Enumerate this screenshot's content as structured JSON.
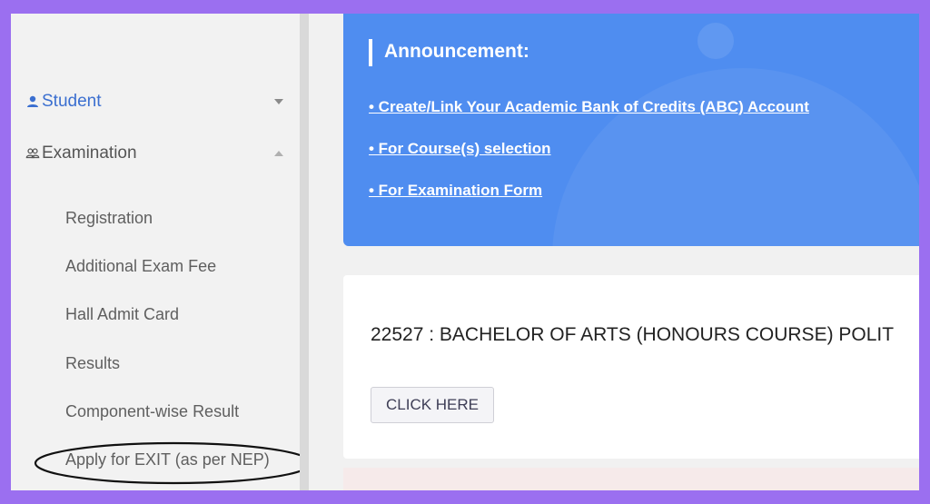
{
  "sidebar": {
    "student": {
      "label": "Student",
      "icon": "person-icon",
      "expanded": false
    },
    "examination": {
      "label": "Examination",
      "icon": "group-icon",
      "expanded": true,
      "items": [
        {
          "label": "Registration"
        },
        {
          "label": "Additional Exam Fee"
        },
        {
          "label": "Hall Admit Card"
        },
        {
          "label": "Results"
        },
        {
          "label": "Component-wise Result"
        },
        {
          "label": "Apply for EXIT (as per NEP)"
        }
      ]
    }
  },
  "announcement": {
    "title": "Announcement:",
    "links": [
      "• Create/Link Your Academic Bank of Credits (ABC) Account",
      "• For Course(s) selection",
      "• For Examination Form"
    ]
  },
  "course": {
    "title": "22527 : BACHELOR OF ARTS (HONOURS COURSE) POLIT",
    "button_label": "CLICK HERE"
  },
  "colors": {
    "accent_blue": "#4f8df0",
    "link_blue": "#3b6fd0",
    "frame_purple": "#9b6ff0"
  }
}
